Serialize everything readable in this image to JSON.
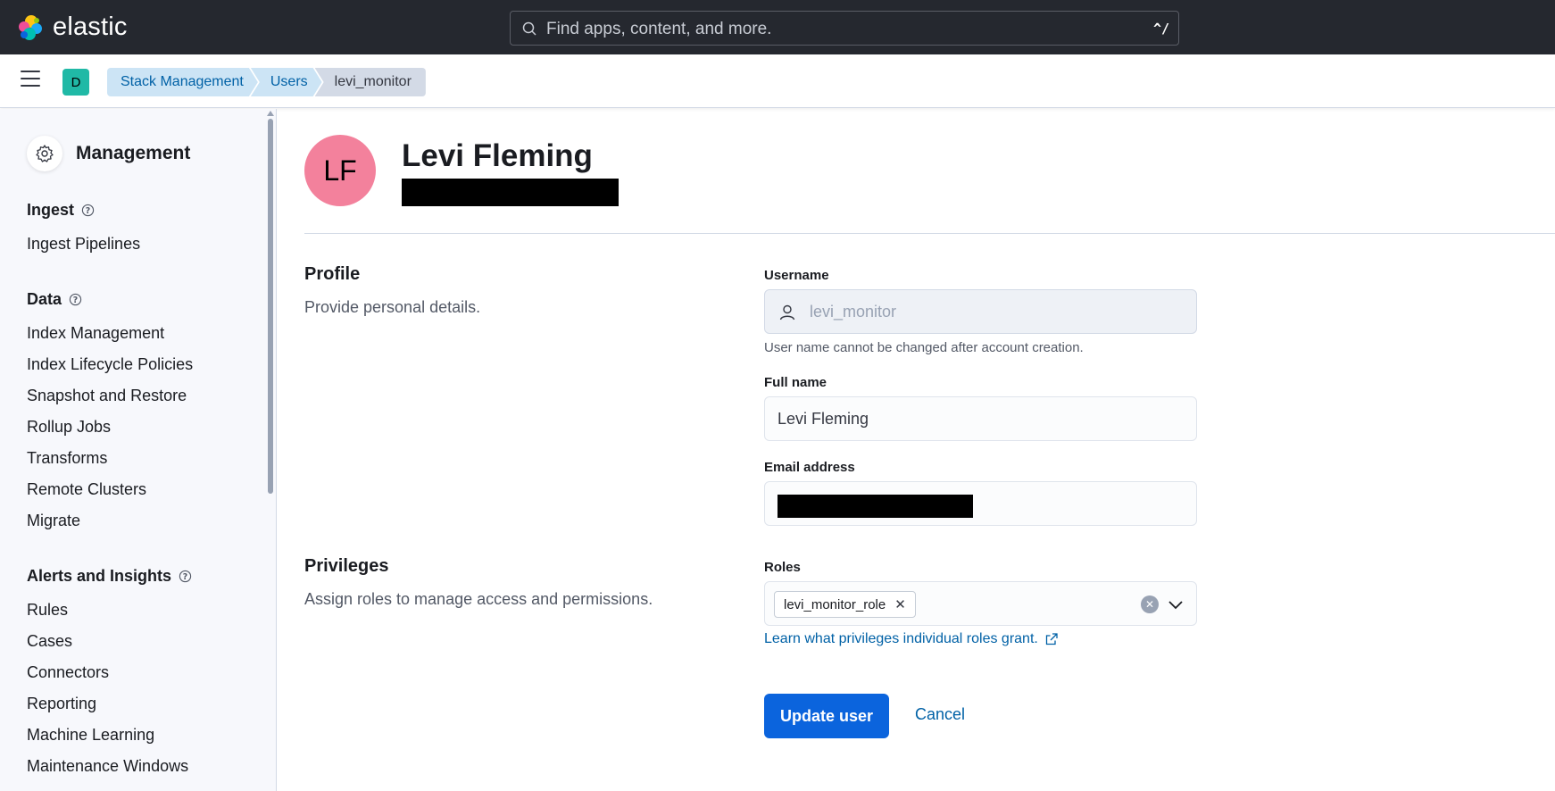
{
  "header": {
    "logo_text": "elastic",
    "search_placeholder": "Find apps, content, and more.",
    "search_shortcut": "^/"
  },
  "nav": {
    "space_initial": "D",
    "breadcrumbs": [
      "Stack Management",
      "Users",
      "levi_monitor"
    ]
  },
  "sidebar": {
    "title": "Management",
    "groups": [
      {
        "title": "Ingest",
        "items": [
          "Ingest Pipelines"
        ]
      },
      {
        "title": "Data",
        "items": [
          "Index Management",
          "Index Lifecycle Policies",
          "Snapshot and Restore",
          "Rollup Jobs",
          "Transforms",
          "Remote Clusters",
          "Migrate"
        ]
      },
      {
        "title": "Alerts and Insights",
        "items": [
          "Rules",
          "Cases",
          "Connectors",
          "Reporting",
          "Machine Learning",
          "Maintenance Windows"
        ]
      }
    ]
  },
  "user": {
    "initials": "LF",
    "full_name_title": "Levi Fleming"
  },
  "profile": {
    "title": "Profile",
    "description": "Provide personal details.",
    "username_label": "Username",
    "username_value": "levi_monitor",
    "username_help": "User name cannot be changed after account creation.",
    "fullname_label": "Full name",
    "fullname_value": "Levi Fleming",
    "email_label": "Email address"
  },
  "privileges": {
    "title": "Privileges",
    "description": "Assign roles to manage access and permissions.",
    "roles_label": "Roles",
    "roles": [
      "levi_monitor_role"
    ],
    "learn_link": "Learn what privileges individual roles grant."
  },
  "actions": {
    "update": "Update user",
    "cancel": "Cancel"
  },
  "colors": {
    "header_bg": "#25282f",
    "primary": "#0b64dd",
    "link": "#0061a6",
    "avatar": "#f3819c",
    "space_badge": "#20b9a6"
  }
}
